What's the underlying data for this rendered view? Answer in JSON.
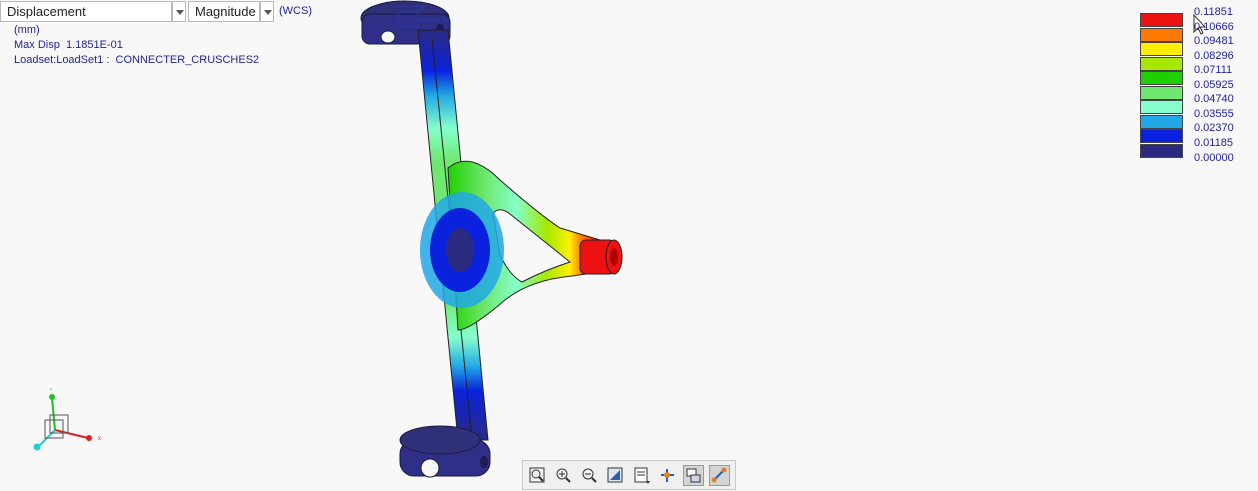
{
  "toolbar_top": {
    "result_quantity": "Displacement",
    "component": "Magnitude",
    "coord_system": "(WCS)"
  },
  "info": {
    "units": "(mm)",
    "max_disp": "Max Disp  1.1851E-01",
    "loadset": "Loadset:LoadSet1 :  CONNECTER_CRUSCHES2"
  },
  "legend": {
    "values": [
      "0.11851",
      "0.10666",
      "0.09481",
      "0.08296",
      "0.07111",
      "0.05925",
      "0.04740",
      "0.03555",
      "0.02370",
      "0.01185",
      "0.00000"
    ],
    "colors": [
      "#ee1111",
      "#ff7a00",
      "#ffee00",
      "#a6e800",
      "#1fd000",
      "#70e870",
      "#86ffcc",
      "#22a8e6",
      "#0a22dd",
      "#2a2a80"
    ]
  },
  "viewer_toolbar": {
    "buttons": [
      {
        "name": "zoom-fit-icon"
      },
      {
        "name": "zoom-in-icon"
      },
      {
        "name": "zoom-out-icon"
      },
      {
        "name": "refit-icon"
      },
      {
        "name": "saved-views-icon"
      },
      {
        "name": "spin-center-icon"
      },
      {
        "name": "display-style-icon",
        "active": true
      },
      {
        "name": "datum-display-icon",
        "active": true
      }
    ]
  },
  "axis_triad": {
    "x_label": "x",
    "y_label": "y"
  }
}
